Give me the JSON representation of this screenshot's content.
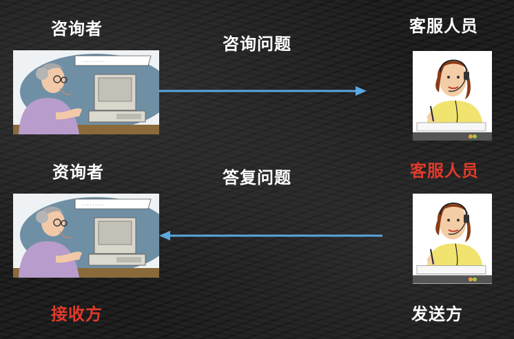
{
  "labels": {
    "left_top": "咨询者",
    "mid_top": "咨询问题",
    "right_top": "客服人员",
    "left_mid": "资询者",
    "mid_mid": "答复问题",
    "right_mid": "客服人员",
    "left_bottom": "接收方",
    "right_bottom": "发送方"
  },
  "colors": {
    "arrow": "#5ba7e0",
    "highlight_red": "#e23a2a",
    "text": "#ffffff"
  },
  "icons": {
    "consultant": "elderly-woman-at-computer-icon",
    "agent": "customer-service-agent-headset-icon"
  }
}
